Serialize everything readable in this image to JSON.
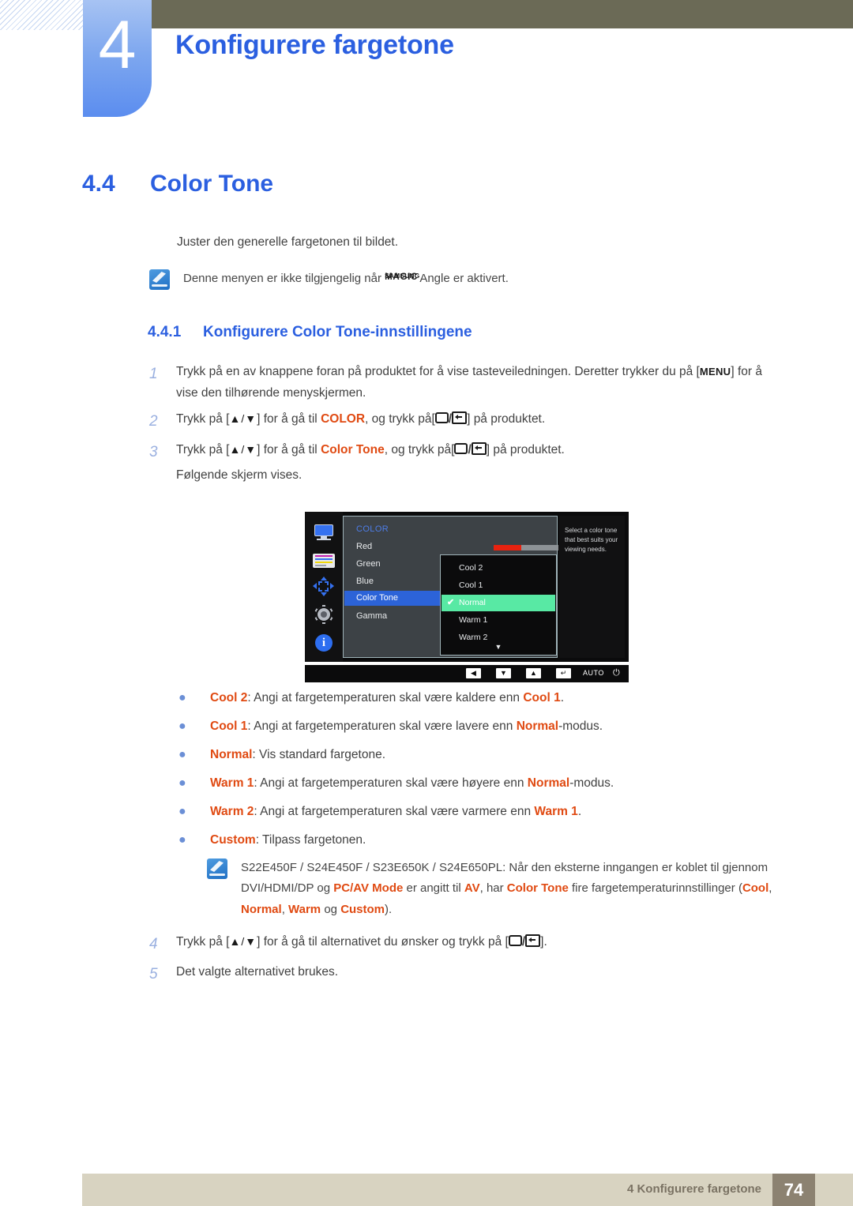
{
  "header": {
    "chapter_number": "4",
    "chapter_title": "Konfigurere fargetone"
  },
  "section": {
    "number": "4.4",
    "title": "Color Tone",
    "intro": "Juster den generelle fargetonen til bildet."
  },
  "note_top": {
    "icon": "note-pen-icon",
    "text_before": "Denne menyen er ikke tilgjengelig når ",
    "magic_samsung": "SAMSUNG",
    "magic_magic": "MAGIC",
    "magic_angle": "Angle",
    "text_after": " er aktivert."
  },
  "subsection": {
    "number": "4.4.1",
    "title": "Konfigurere Color Tone-innstillingene"
  },
  "steps_top": [
    {
      "num": "1",
      "part1": "Trykk på en av knappene foran på produktet for å vise tasteveiledningen. Deretter trykker du på ",
      "key": "MENU",
      "part2": " for å vise den tilhørende menyskjermen."
    },
    {
      "num": "2",
      "part1": "Trykk på [",
      "arrows": "▲/▼",
      "part2": "] for å gå til ",
      "kw": "COLOR",
      "part3": ", og trykk på[",
      "part4": "] på produktet."
    },
    {
      "num": "3",
      "part1": "Trykk på [",
      "arrows": "▲/▼",
      "part2": "] for å gå til ",
      "kw": "Color Tone",
      "part3": ", og trykk på[",
      "part4": "] på produktet.",
      "sub_line": "Følgende skjerm vises."
    }
  ],
  "osd": {
    "menu_title": "COLOR",
    "menu_items": [
      "Red",
      "Green",
      "Blue",
      "Color Tone",
      "Gamma"
    ],
    "selected_item": "Color Tone",
    "slider_value": "50",
    "help_text": "Select a color tone that best suits your viewing needs.",
    "dropdown_options": [
      "Cool 2",
      "Cool 1",
      "Normal",
      "Warm 1",
      "Warm 2"
    ],
    "dropdown_selected": "Normal",
    "dropdown_check": "✔",
    "more_arrow": "▼",
    "sidebar_icons": [
      "monitor-icon",
      "color-bars-icon",
      "position-arrows-icon",
      "gear-icon",
      "info-icon"
    ],
    "info_glyph": "i",
    "keybar": {
      "left": "◀",
      "down": "▼",
      "up": "▲",
      "enter": "↵",
      "auto": "AUTO",
      "power": "⏻"
    }
  },
  "bullets": [
    {
      "dot": "●",
      "term": "Cool 2",
      "mid": ": Angi at fargetemperaturen skal være kaldere enn ",
      "term2": "Cool 1",
      "end": "."
    },
    {
      "dot": "●",
      "term": "Cool 1",
      "mid": ": Angi at fargetemperaturen skal være lavere enn ",
      "term2": "Normal",
      "end": "-modus."
    },
    {
      "dot": "●",
      "term": "Normal",
      "mid": ": Vis standard fargetone.",
      "term2": "",
      "end": ""
    },
    {
      "dot": "●",
      "term": "Warm 1",
      "mid": ": Angi at fargetemperaturen skal være høyere enn ",
      "term2": "Normal",
      "end": "-modus."
    },
    {
      "dot": "●",
      "term": "Warm 2",
      "mid": ": Angi at fargetemperaturen skal være varmere enn ",
      "term2": "Warm 1",
      "end": "."
    },
    {
      "dot": "●",
      "term": "Custom",
      "mid": ": Tilpass fargetonen.",
      "term2": "",
      "end": ""
    }
  ],
  "note_bottom": {
    "icon": "note-pen-icon",
    "p1": "S22E450F / S24E450F / S23E650K / S24E650PL: Når den eksterne inngangen er koblet til gjennom DVI/HDMI/DP og ",
    "kw1": "PC/AV Mode",
    "p2": " er angitt til ",
    "kw2": "AV",
    "p3": ", har ",
    "kw3": "Color Tone",
    "p4": " fire fargetemperaturinnstillinger (",
    "kw4": "Cool",
    "p5": ", ",
    "kw5": "Normal",
    "p6": ", ",
    "kw6": "Warm",
    "p7": " og ",
    "kw7": "Custom",
    "p8": ")."
  },
  "steps_bottom": [
    {
      "num": "4",
      "part1": "Trykk på [",
      "arrows": "▲/▼",
      "part2": "] for å gå til alternativet du ønsker og trykk på [",
      "part3": "]."
    },
    {
      "num": "5",
      "part1": "Det valgte alternativet brukes."
    }
  ],
  "footer": {
    "text": "4 Konfigurere fargetone",
    "page": "74"
  },
  "colors": {
    "heading_blue": "#2b5fe0",
    "keyword_orange": "#e04a12",
    "olive_bar": "#6b6a56",
    "footer_beige": "#d8d3c1",
    "footer_page_box": "#8c8271",
    "osd_highlight_blue": "#2c63d8",
    "osd_dropdown_green": "#58e9a4",
    "osd_slider_red": "#e8220f"
  }
}
